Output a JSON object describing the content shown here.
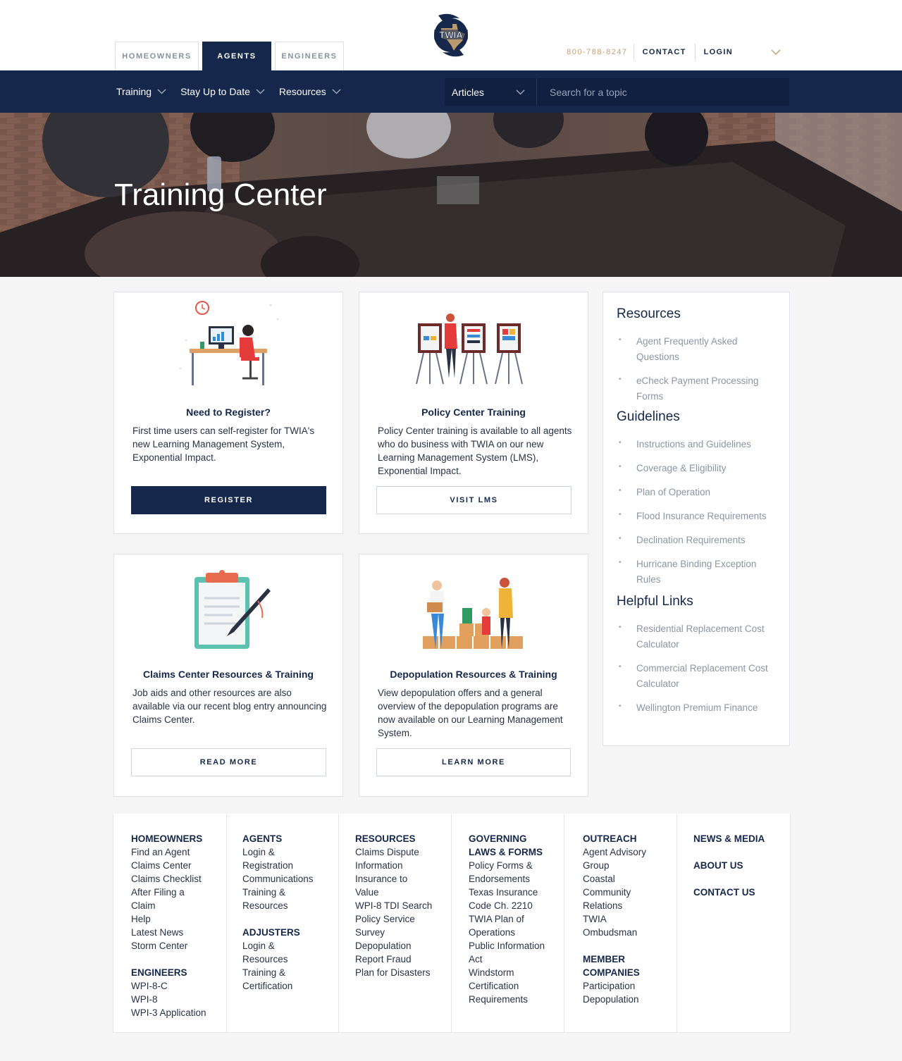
{
  "header": {
    "audience_tabs": [
      {
        "label": "HOMEOWNERS",
        "active": false
      },
      {
        "label": "AGENTS",
        "active": true
      },
      {
        "label": "ENGINEERS",
        "active": false
      }
    ],
    "logo_text": "TWIA",
    "phone": "800-788-8247",
    "contact_label": "CONTACT",
    "login_label": "LOGIN"
  },
  "nav": {
    "items": [
      "Training",
      "Stay Up to Date",
      "Resources"
    ],
    "search_select": "Articles",
    "search_placeholder": "Search for a topic"
  },
  "hero": {
    "title": "Training Center"
  },
  "cards": [
    {
      "title": "Need to Register?",
      "text": "First time users can self-register for TWIA's new Learning Management System, Exponential Impact.",
      "button": "REGISTER"
    },
    {
      "title": "Policy Center Training",
      "text": "Policy Center training is available to all agents who do business with TWIA on our new Learning Management System (LMS), Exponential Impact.",
      "button": "VISIT LMS"
    },
    {
      "title": "Claims Center Resources & Training",
      "text": "Job aids and other resources are also available via our recent blog entry announcing Claims Center.",
      "button": "READ MORE"
    },
    {
      "title": "Depopulation Resources & Training",
      "text": "View depopulation offers and a general overview of the depopulation programs are now available on our Learning Management System.",
      "button": "LEARN MORE"
    }
  ],
  "sidebar": {
    "resources_heading": "Resources",
    "resources": [
      "Agent Frequently Asked Questions",
      "eCheck Payment Processing Forms"
    ],
    "guidelines_heading": "Guidelines",
    "guidelines": [
      "Instructions and Guidelines",
      "Coverage & Eligibility",
      "Plan of Operation",
      "Flood Insurance Requirements",
      "Declination Requirements",
      "Hurricane Binding Exception Rules"
    ],
    "helpful_heading": "Helpful Links",
    "helpful": [
      "Residential Replacement Cost Calculator",
      "Commercial Replacement Cost Calculator",
      "Wellington Premium Finance"
    ]
  },
  "footer": {
    "homeowners": {
      "heading": "HOMEOWNERS",
      "links": [
        "Find an Agent",
        "Claims Center",
        "Claims Checklist",
        "After Filing a Claim",
        "Help",
        "Latest News",
        "Storm Center"
      ]
    },
    "engineers": {
      "heading": "ENGINEERS",
      "links": [
        "WPI-8-C",
        "WPI-8",
        "WPI-3 Application"
      ]
    },
    "agents": {
      "heading": "AGENTS",
      "links": [
        "Login & Registration",
        "Communications",
        "Training & Resources"
      ]
    },
    "adjusters": {
      "heading": "ADJUSTERS",
      "links": [
        "Login & Resources",
        "Training & Certification"
      ]
    },
    "resources": {
      "heading": "RESOURCES",
      "links": [
        "Claims Dispute Information",
        "Insurance to Value",
        "WPI-8 TDI Search",
        "Policy Service Survey",
        "Depopulation",
        "Report Fraud",
        "Plan for Disasters"
      ]
    },
    "governing": {
      "heading": "GOVERNING LAWS & FORMS",
      "links": [
        "Policy Forms & Endorsements",
        "Texas Insurance Code Ch. 2210",
        "TWIA Plan of Operations",
        "Public Information Act",
        "Windstorm Certification Requirements"
      ]
    },
    "outreach": {
      "heading": "OUTREACH",
      "links": [
        "Agent Advisory Group",
        "Coastal Community Relations",
        "TWIA Ombudsman"
      ]
    },
    "member": {
      "heading": "MEMBER COMPANIES",
      "links": [
        "Participation",
        "Depopulation"
      ]
    },
    "news_media": "NEWS & MEDIA",
    "about_us": "ABOUT US",
    "contact_us": "CONTACT US"
  },
  "colors": {
    "navy": "#15284c",
    "phone_gold": "#c79e73",
    "link_gray": "#8d94a3"
  }
}
